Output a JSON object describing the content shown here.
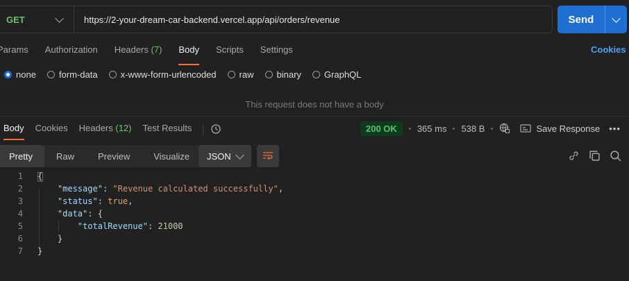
{
  "request": {
    "method": "GET",
    "url": "https://2-your-dream-car-backend.vercel.app/api/orders/revenue",
    "send_label": "Send"
  },
  "request_tabs": [
    {
      "label": "Params",
      "count": ""
    },
    {
      "label": "Authorization",
      "count": ""
    },
    {
      "label": "Headers",
      "count": "(7)"
    },
    {
      "label": "Body",
      "count": ""
    },
    {
      "label": "Scripts",
      "count": ""
    },
    {
      "label": "Settings",
      "count": ""
    }
  ],
  "cookies_label": "Cookies",
  "body_types": [
    "none",
    "form-data",
    "x-www-form-urlencoded",
    "raw",
    "binary",
    "GraphQL"
  ],
  "selected_body_type": "none",
  "no_body_message": "This request does not have a body",
  "response_tabs": [
    {
      "label": "Body",
      "count": ""
    },
    {
      "label": "Cookies",
      "count": ""
    },
    {
      "label": "Headers",
      "count": "(12)"
    },
    {
      "label": "Test Results",
      "count": ""
    }
  ],
  "response": {
    "status": "200 OK",
    "time": "365 ms",
    "size": "538 B",
    "save_label": "Save Response"
  },
  "view_modes": [
    "Pretty",
    "Raw",
    "Preview",
    "Visualize"
  ],
  "active_view": "Pretty",
  "format": "JSON",
  "code_lines": [
    "1",
    "2",
    "3",
    "4",
    "5",
    "6",
    "7"
  ],
  "json_body": {
    "open_brace": "{",
    "message_key": "\"message\"",
    "message_value": "\"Revenue calculated successfully\"",
    "status_key": "\"status\"",
    "status_value": "true",
    "data_key": "\"data\"",
    "data_open": "{",
    "total_key": "\"totalRevenue\"",
    "total_value": "21000",
    "data_close": "}",
    "close_brace": "}"
  },
  "colors": {
    "background": "#212121",
    "accent_orange": "#ff6c37",
    "send_blue": "#1f6fd1",
    "method_green": "#6bc36b",
    "link_blue": "#4ea0f5"
  }
}
